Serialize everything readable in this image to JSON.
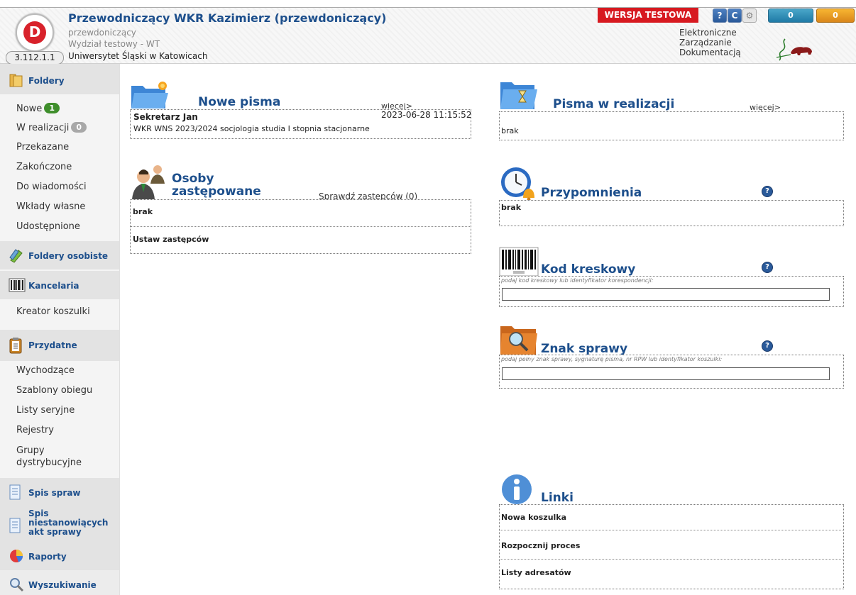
{
  "header": {
    "user_title": "Przewodniczący WKR Kazimierz (przewdoniczący)",
    "role": "przewdoniczący",
    "department": "Wydział testowy - WT",
    "university": "Uniwersytet Śląski w Katowicach",
    "version": "3.112.1.1",
    "test_badge": "WERSJA TESTOWA",
    "help_icon": "?",
    "refresh_icon": "C",
    "settings_icon": "⚙",
    "counter_blue": "0",
    "counter_orange": "0",
    "ezd_line1": "Elektroniczne",
    "ezd_line2": "Zarządzanie",
    "ezd_line3": "Dokumentacją",
    "logo_letter": "D"
  },
  "sidebar": {
    "foldery": "Foldery",
    "nowe": "Nowe",
    "nowe_count": "1",
    "w_realizacji": "W realizacji",
    "w_realizacji_count": "0",
    "przekazane": "Przekazane",
    "zakonczone": "Zakończone",
    "do_wiadomosci": "Do wiadomości",
    "wklady_wlasne": "Wkłady własne",
    "udostepnione": "Udostępnione",
    "foldery_osobiste": "Foldery osobiste",
    "kancelaria": "Kancelaria",
    "kreator_koszulki": "Kreator koszulki",
    "przydatne": "Przydatne",
    "wychodzace": "Wychodzące",
    "szablony_obiegu": "Szablony obiegu",
    "listy_seryjne": "Listy seryjne",
    "rejestry": "Rejestry",
    "grupy1": "Grupy",
    "grupy2": "dystrybucyjne",
    "spis_spraw": "Spis spraw",
    "spis_niest1": "Spis",
    "spis_niest2": "niestanowiących",
    "spis_niest3": "akt sprawy",
    "raporty": "Raporty",
    "wyszukiwanie": "Wyszukiwanie"
  },
  "nowe_pisma": {
    "title": "Nowe pisma",
    "more": "więcej>",
    "sender": "Sekretarz Jan",
    "date": "2023-06-28 11:15:52",
    "subject": "WKR WNS 2023/2024 socjologia studia I stopnia stacjonarne"
  },
  "osoby": {
    "title1": "Osoby",
    "title2": "zastępowane",
    "check": "Sprawdź zastępców (0)",
    "empty": "brak",
    "set": "Ustaw zastępców"
  },
  "pisma_realizacja": {
    "title": "Pisma w realizacji",
    "more": "więcej>",
    "empty": "brak"
  },
  "przypomnienia": {
    "title": "Przypomnienia",
    "empty": "brak",
    "help": "?"
  },
  "kod_kreskowy": {
    "title": "Kod kreskowy",
    "hint": "podaj kod kreskowy lub identyfikator korespondencji:",
    "value": "",
    "help": "?"
  },
  "znak_sprawy": {
    "title": "Znak sprawy",
    "hint": "podaj pełny znak sprawy, sygnaturę pisma, nr RPW lub identyfikator koszulki:",
    "value": "",
    "help": "?"
  },
  "linki": {
    "title": "Linki",
    "nowa_koszulka": "Nowa koszulka",
    "rozpocznij": "Rozpocznij proces",
    "listy_adresatow": "Listy adresatów"
  },
  "colors": {
    "accent": "#1d4f8c",
    "test_red": "#d71920",
    "badge_green": "#3e8e2b"
  }
}
